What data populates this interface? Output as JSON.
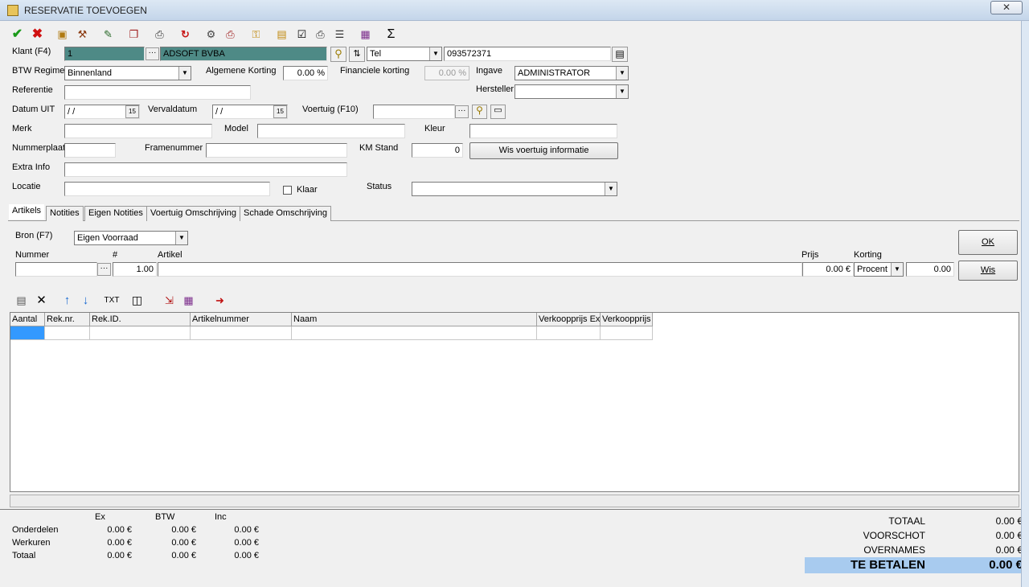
{
  "window": {
    "title": "RESERVATIE TOEVOEGEN",
    "close_label": "✕"
  },
  "toolbar": {
    "icons": [
      "confirm-icon",
      "cancel-icon",
      "customer-icon",
      "tools-icon",
      "edit-icon",
      "copy-icon",
      "print-icon",
      "refresh-icon",
      "wrench-icon",
      "print2-icon",
      "lock-icon",
      "folder-icon",
      "checklist-icon",
      "print3-icon",
      "printer-stack-icon",
      "document-icon",
      "sum-icon"
    ]
  },
  "form": {
    "klant_label": "Klant (F4)",
    "klant_nr": "1",
    "klant_naam": "ADSOFT BVBA",
    "contact_type": "Tel",
    "telefoon": "093572371",
    "btw_label": "BTW Regime",
    "btw_value": "Binnenland",
    "alg_korting_label": "Algemene Korting",
    "alg_korting_value": "0.00 %",
    "fin_korting_label": "Financiele korting",
    "fin_korting_value": "0.00 %",
    "ingave_label": "Ingave",
    "ingave_value": "ADMINISTRATOR",
    "referentie_label": "Referentie",
    "hersteller_label": "Hersteller",
    "datum_uit_label": "Datum UIT",
    "datum_uit_value": " / /",
    "vervaldatum_label": "Vervaldatum",
    "vervaldatum_value": " / /",
    "cal_label": "15",
    "voertuig_label": "Voertuig (F10)",
    "merk_label": "Merk",
    "model_label": "Model",
    "kleur_label": "Kleur",
    "nummerplaat_label": "Nummerplaat",
    "framenummer_label": "Framenummer",
    "km_label": "KM Stand",
    "km_value": "0",
    "wis_voertuig_label": "Wis voertuig informatie",
    "extra_info_label": "Extra Info",
    "locatie_label": "Locatie",
    "klaar_label": "Klaar",
    "status_label": "Status"
  },
  "tabs": [
    "Artikels",
    "Notities",
    "Eigen Notities",
    "Voertuig Omschrijving",
    "Schade Omschrijving"
  ],
  "artikel": {
    "bron_label": "Bron (F7)",
    "bron_value": "Eigen Voorraad",
    "nummer_label": "Nummer",
    "aantal_label": "#",
    "aantal_value": "1.00",
    "artikel_label": "Artikel",
    "prijs_label": "Prijs",
    "prijs_value": "0.00 €",
    "korting_label": "Korting",
    "korting_type": "Procent",
    "korting_value": "0.00",
    "ok_label": "OK",
    "wis_label": "Wis",
    "txt_label": "TXT"
  },
  "grid": {
    "columns": [
      "Aantal",
      "Rek.nr.",
      "Rek.ID.",
      "Artikelnummer",
      "Naam",
      "Verkoopprijs Ex",
      "Verkoopprijs"
    ]
  },
  "summary": {
    "headers": [
      "Ex",
      "BTW",
      "Inc"
    ],
    "rows": [
      {
        "label": "Onderdelen",
        "ex": "0.00 €",
        "btw": "0.00 €",
        "inc": "0.00 €"
      },
      {
        "label": "Werkuren",
        "ex": "0.00 €",
        "btw": "0.00 €",
        "inc": "0.00 €"
      },
      {
        "label": "Totaal",
        "ex": "0.00 €",
        "btw": "0.00 €",
        "inc": "0.00 €"
      }
    ]
  },
  "totals": {
    "totaal_label": "TOTAAL",
    "totaal_value": "0.00 €",
    "voorschot_label": "VOORSCHOT",
    "voorschot_value": "0.00 €",
    "overnames_label": "OVERNAMES",
    "overnames_value": "0.00 €",
    "te_betalen_label": "TE BETALEN",
    "te_betalen_value": "0.00 €"
  },
  "colors": {
    "teal": "#4e8a86",
    "highlight": "#a8cbef",
    "select": "#3399ff"
  }
}
